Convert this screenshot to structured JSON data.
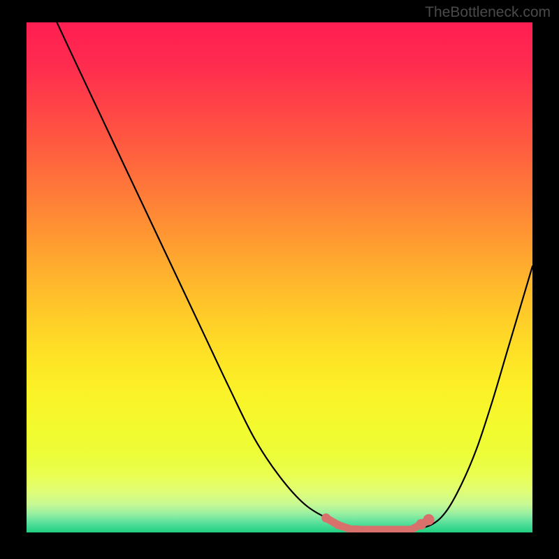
{
  "watermark": "TheBottleneck.com",
  "chart_data": {
    "type": "line",
    "title": "",
    "xlabel": "",
    "ylabel": "",
    "xlim": [
      0,
      100
    ],
    "ylim": [
      0,
      100
    ],
    "curve": {
      "description": "V-shaped bottleneck curve, steep descent on left, flat valley near x≈68-78, rising on right",
      "points_normalized": [
        [
          0.06,
          0.0
        ],
        [
          0.1,
          0.085
        ],
        [
          0.15,
          0.19
        ],
        [
          0.2,
          0.295
        ],
        [
          0.25,
          0.4
        ],
        [
          0.3,
          0.505
        ],
        [
          0.35,
          0.61
        ],
        [
          0.4,
          0.715
        ],
        [
          0.45,
          0.815
        ],
        [
          0.5,
          0.89
        ],
        [
          0.55,
          0.945
        ],
        [
          0.6,
          0.975
        ],
        [
          0.64,
          0.99
        ],
        [
          0.68,
          0.9945
        ],
        [
          0.72,
          0.9945
        ],
        [
          0.76,
          0.994
        ],
        [
          0.8,
          0.985
        ],
        [
          0.83,
          0.958
        ],
        [
          0.86,
          0.905
        ],
        [
          0.89,
          0.835
        ],
        [
          0.92,
          0.745
        ],
        [
          0.95,
          0.645
        ],
        [
          0.98,
          0.545
        ],
        [
          1.0,
          0.478
        ]
      ]
    },
    "valley_markers": {
      "color": "#d8716b",
      "points_normalized": [
        [
          0.592,
          0.9715
        ],
        [
          0.616,
          0.9855
        ],
        [
          0.64,
          0.9935
        ],
        [
          0.664,
          0.9945
        ],
        [
          0.688,
          0.9945
        ],
        [
          0.712,
          0.9945
        ],
        [
          0.736,
          0.9945
        ],
        [
          0.76,
          0.9945
        ],
        [
          0.78,
          0.984
        ],
        [
          0.795,
          0.975
        ]
      ]
    },
    "gradient_stops": [
      {
        "offset": 0.0,
        "color": "#ff1e52"
      },
      {
        "offset": 0.08,
        "color": "#ff2b4f"
      },
      {
        "offset": 0.16,
        "color": "#ff4247"
      },
      {
        "offset": 0.24,
        "color": "#ff5b40"
      },
      {
        "offset": 0.32,
        "color": "#ff763a"
      },
      {
        "offset": 0.4,
        "color": "#ff9133"
      },
      {
        "offset": 0.48,
        "color": "#ffad2e"
      },
      {
        "offset": 0.56,
        "color": "#ffc729"
      },
      {
        "offset": 0.64,
        "color": "#ffdf26"
      },
      {
        "offset": 0.72,
        "color": "#fbf127"
      },
      {
        "offset": 0.8,
        "color": "#f2fb2f"
      },
      {
        "offset": 0.85,
        "color": "#ecfd3a"
      },
      {
        "offset": 0.89,
        "color": "#e9fe53"
      },
      {
        "offset": 0.92,
        "color": "#e0fd76"
      },
      {
        "offset": 0.945,
        "color": "#c7f994"
      },
      {
        "offset": 0.965,
        "color": "#93eea2"
      },
      {
        "offset": 0.98,
        "color": "#5ce19c"
      },
      {
        "offset": 0.99,
        "color": "#3cd890"
      },
      {
        "offset": 1.0,
        "color": "#21cf81"
      }
    ]
  }
}
